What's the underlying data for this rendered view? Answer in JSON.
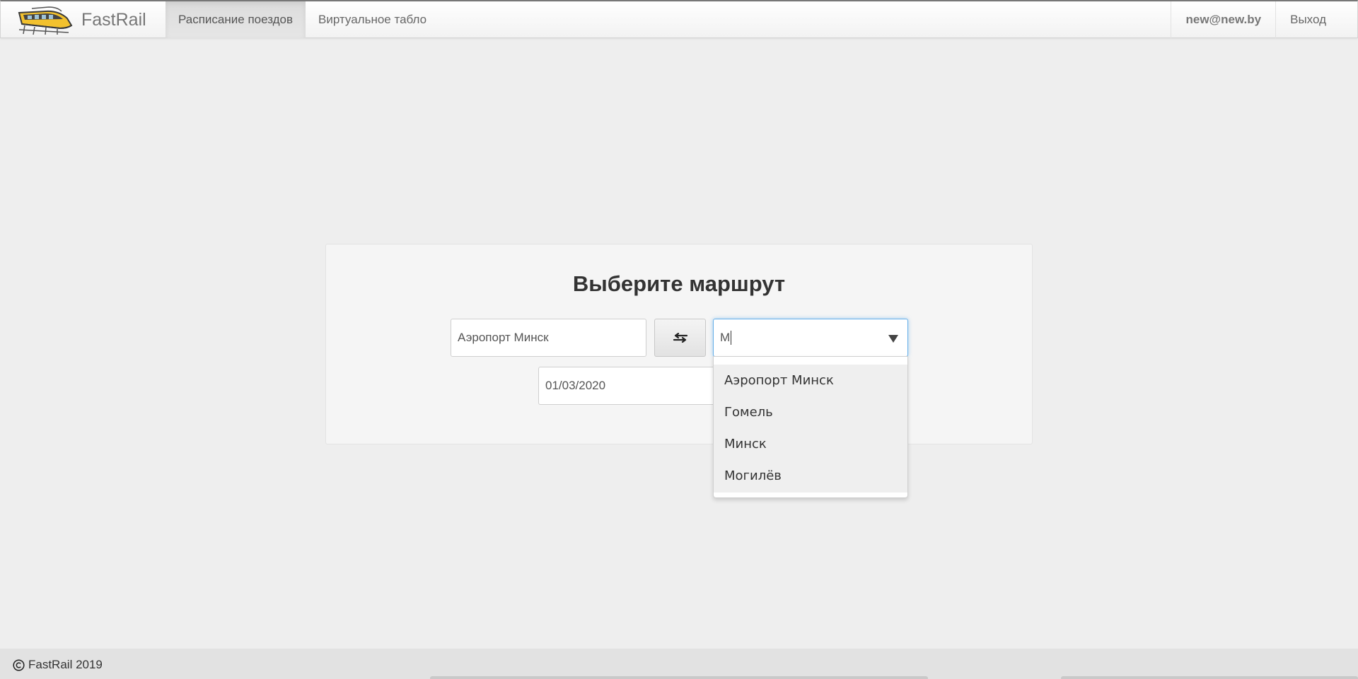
{
  "navbar": {
    "brand": "FastRail",
    "nav_items": [
      {
        "label": "Расписание поездов",
        "active": true
      },
      {
        "label": "Виртуальное табло",
        "active": false
      }
    ],
    "user": "new@new.by",
    "logout": "Выход"
  },
  "route_form": {
    "title": "Выберите маршрут",
    "from_value": "Аэропорт Минск",
    "to_value": "М",
    "date_value": "01/03/2020",
    "swap_icon": "swap-arrows-icon",
    "dropdown_icon": "caret-down-icon"
  },
  "dropdown": {
    "options": [
      "Аэропорт Минск",
      "Гомель",
      "Минск",
      "Могилёв"
    ]
  },
  "footer": {
    "text": "FastRail 2019",
    "icon": "copyright-icon"
  },
  "colors": {
    "background": "#eeeeee",
    "focus_border": "#66afe9",
    "logo_yellow": "#f2c12e"
  }
}
